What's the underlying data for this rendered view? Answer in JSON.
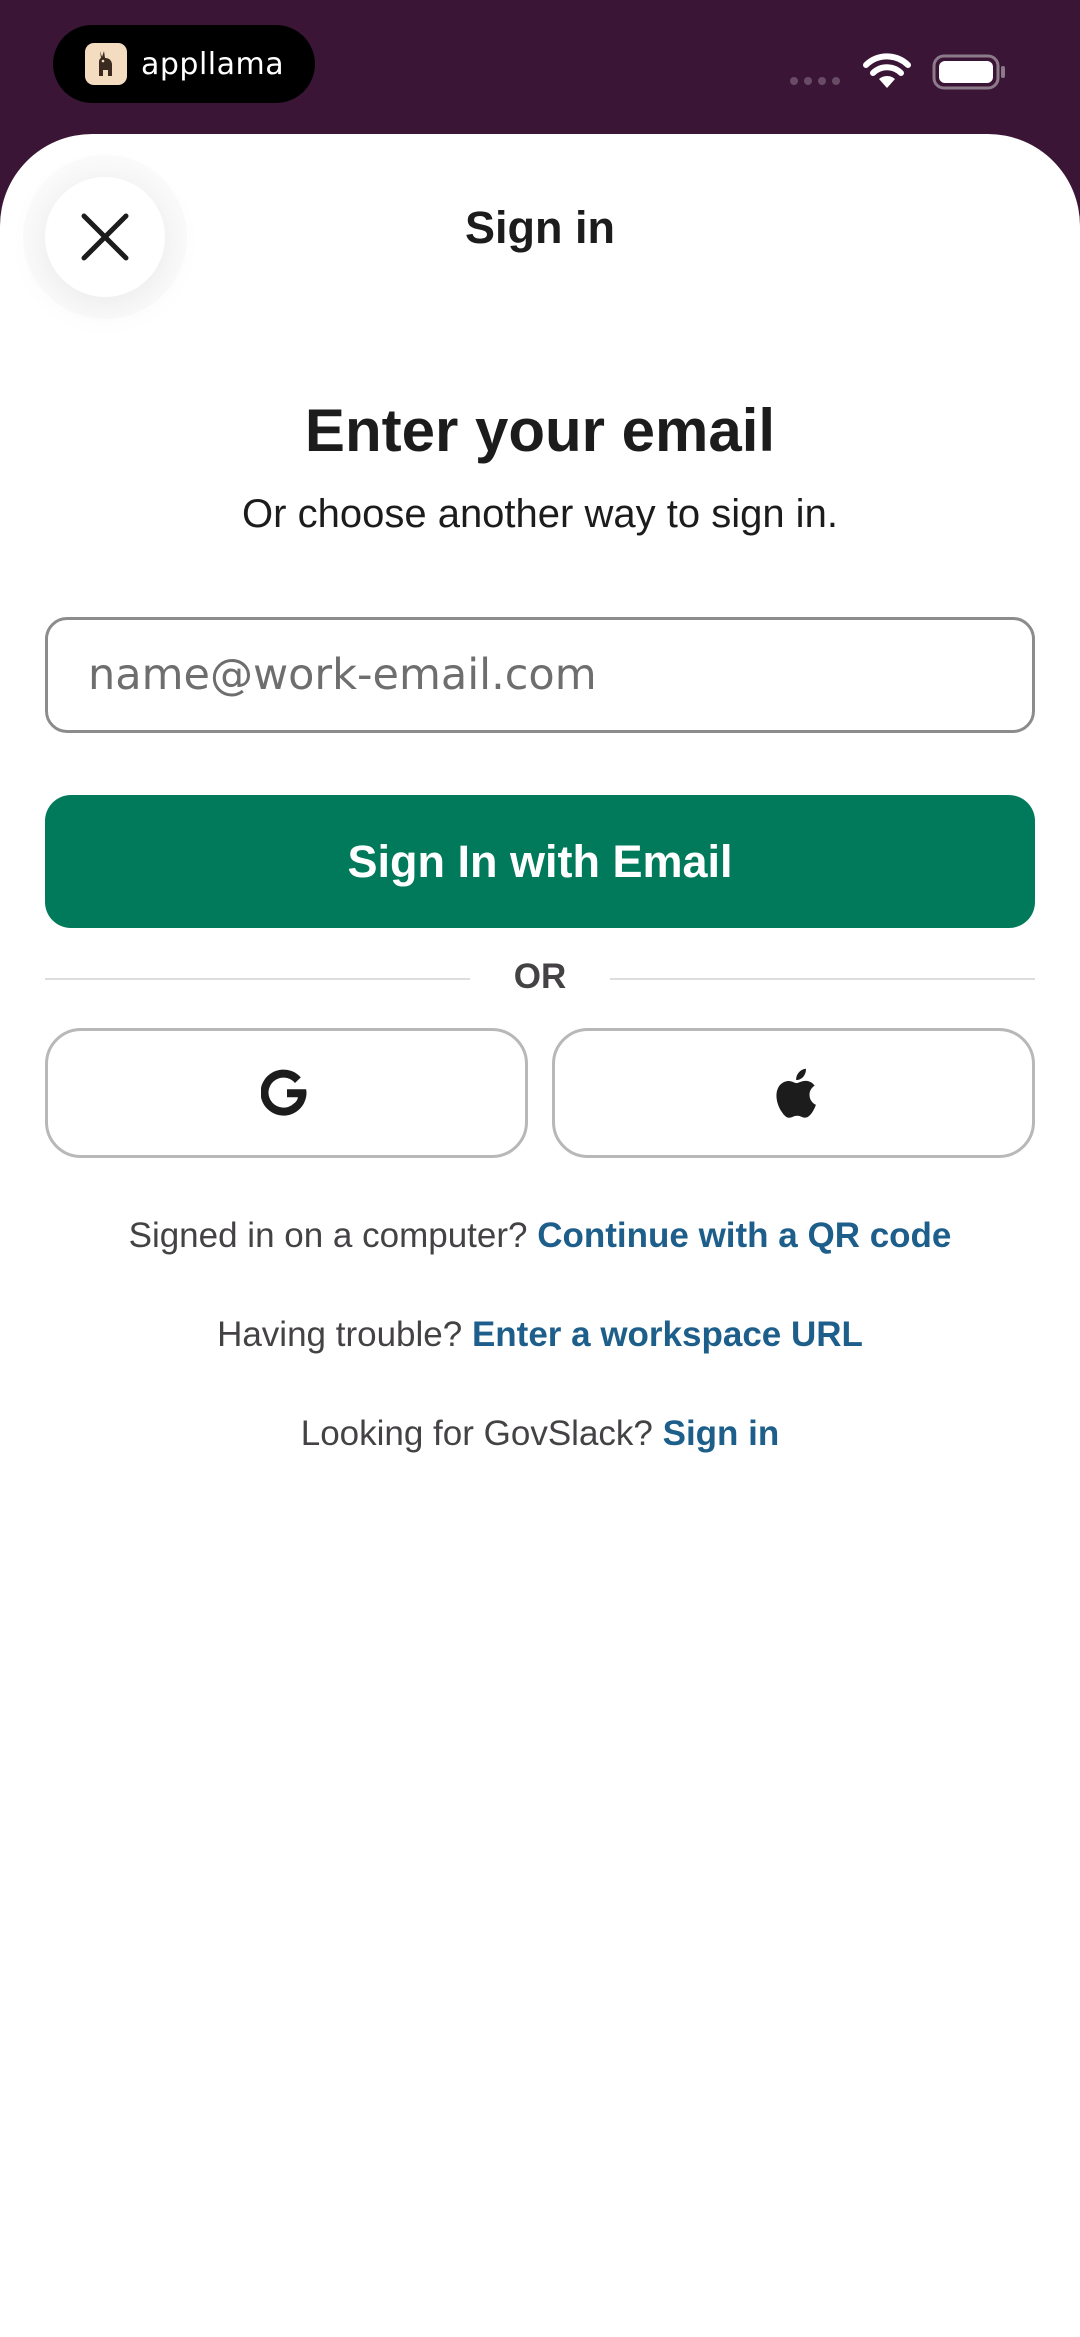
{
  "status_bar": {
    "brand_name": "appllama"
  },
  "header": {
    "title": "Sign in",
    "close_icon": "close-icon"
  },
  "main": {
    "headline": "Enter your email",
    "subhead": "Or choose another way to sign in.",
    "email_placeholder": "name@work-email.com",
    "email_value": "",
    "primary_button_label": "Sign In with Email",
    "divider_label": "OR",
    "social": {
      "google_icon": "google-icon",
      "apple_icon": "apple-icon"
    },
    "help": {
      "qr_prefix": "Signed in on a computer?",
      "qr_link": "Continue with a QR code",
      "workspace_prefix": "Having trouble?",
      "workspace_link": "Enter a workspace URL",
      "govslack_prefix": "Looking for GovSlack?",
      "govslack_link": "Sign in"
    }
  },
  "colors": {
    "status_bar_bg": "#3a1535",
    "primary_button": "#007a5a",
    "link": "#1d5f8a",
    "text": "#1d1c1d"
  }
}
